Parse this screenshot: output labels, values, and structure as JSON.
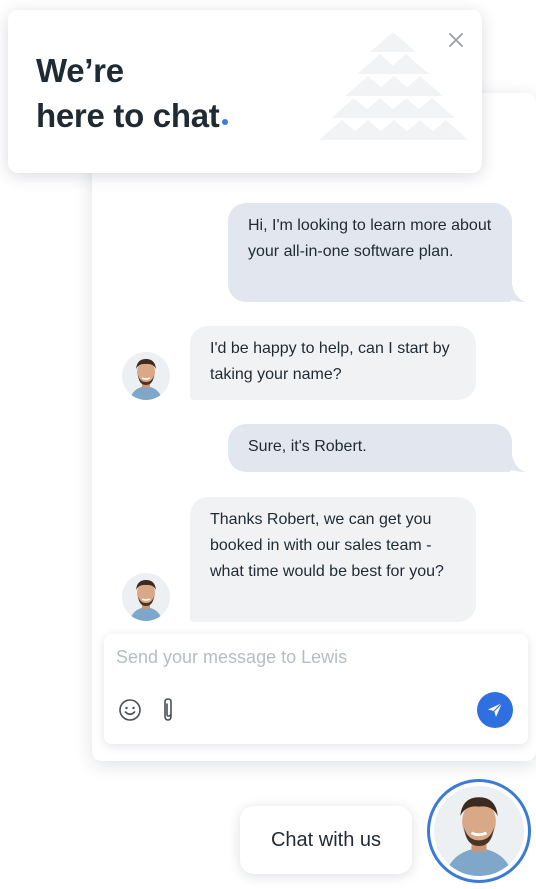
{
  "greeting": {
    "title_line1": "We’re",
    "title_line2": "here to chat",
    "close_icon": "close-icon",
    "accent_color": "#3b7bd6"
  },
  "messages": [
    {
      "from": "user",
      "text": "Hi, I'm looking to learn more about your all-in-one software plan."
    },
    {
      "from": "agent",
      "text": "I'd be happy to help, can I start by taking your name?"
    },
    {
      "from": "user",
      "text": "Sure, it's Robert."
    },
    {
      "from": "agent",
      "text": "Thanks Robert, we can get you booked in with our sales team - what time would be best for you?"
    }
  ],
  "composer": {
    "placeholder": "Send your message to Lewis",
    "value": "",
    "emoji_icon": "smiley-icon",
    "attach_icon": "paperclip-icon",
    "send_icon": "paper-plane-icon",
    "send_color": "#2f6fe0"
  },
  "launcher": {
    "label": "Chat with us",
    "avatar_icon": "agent-avatar"
  }
}
